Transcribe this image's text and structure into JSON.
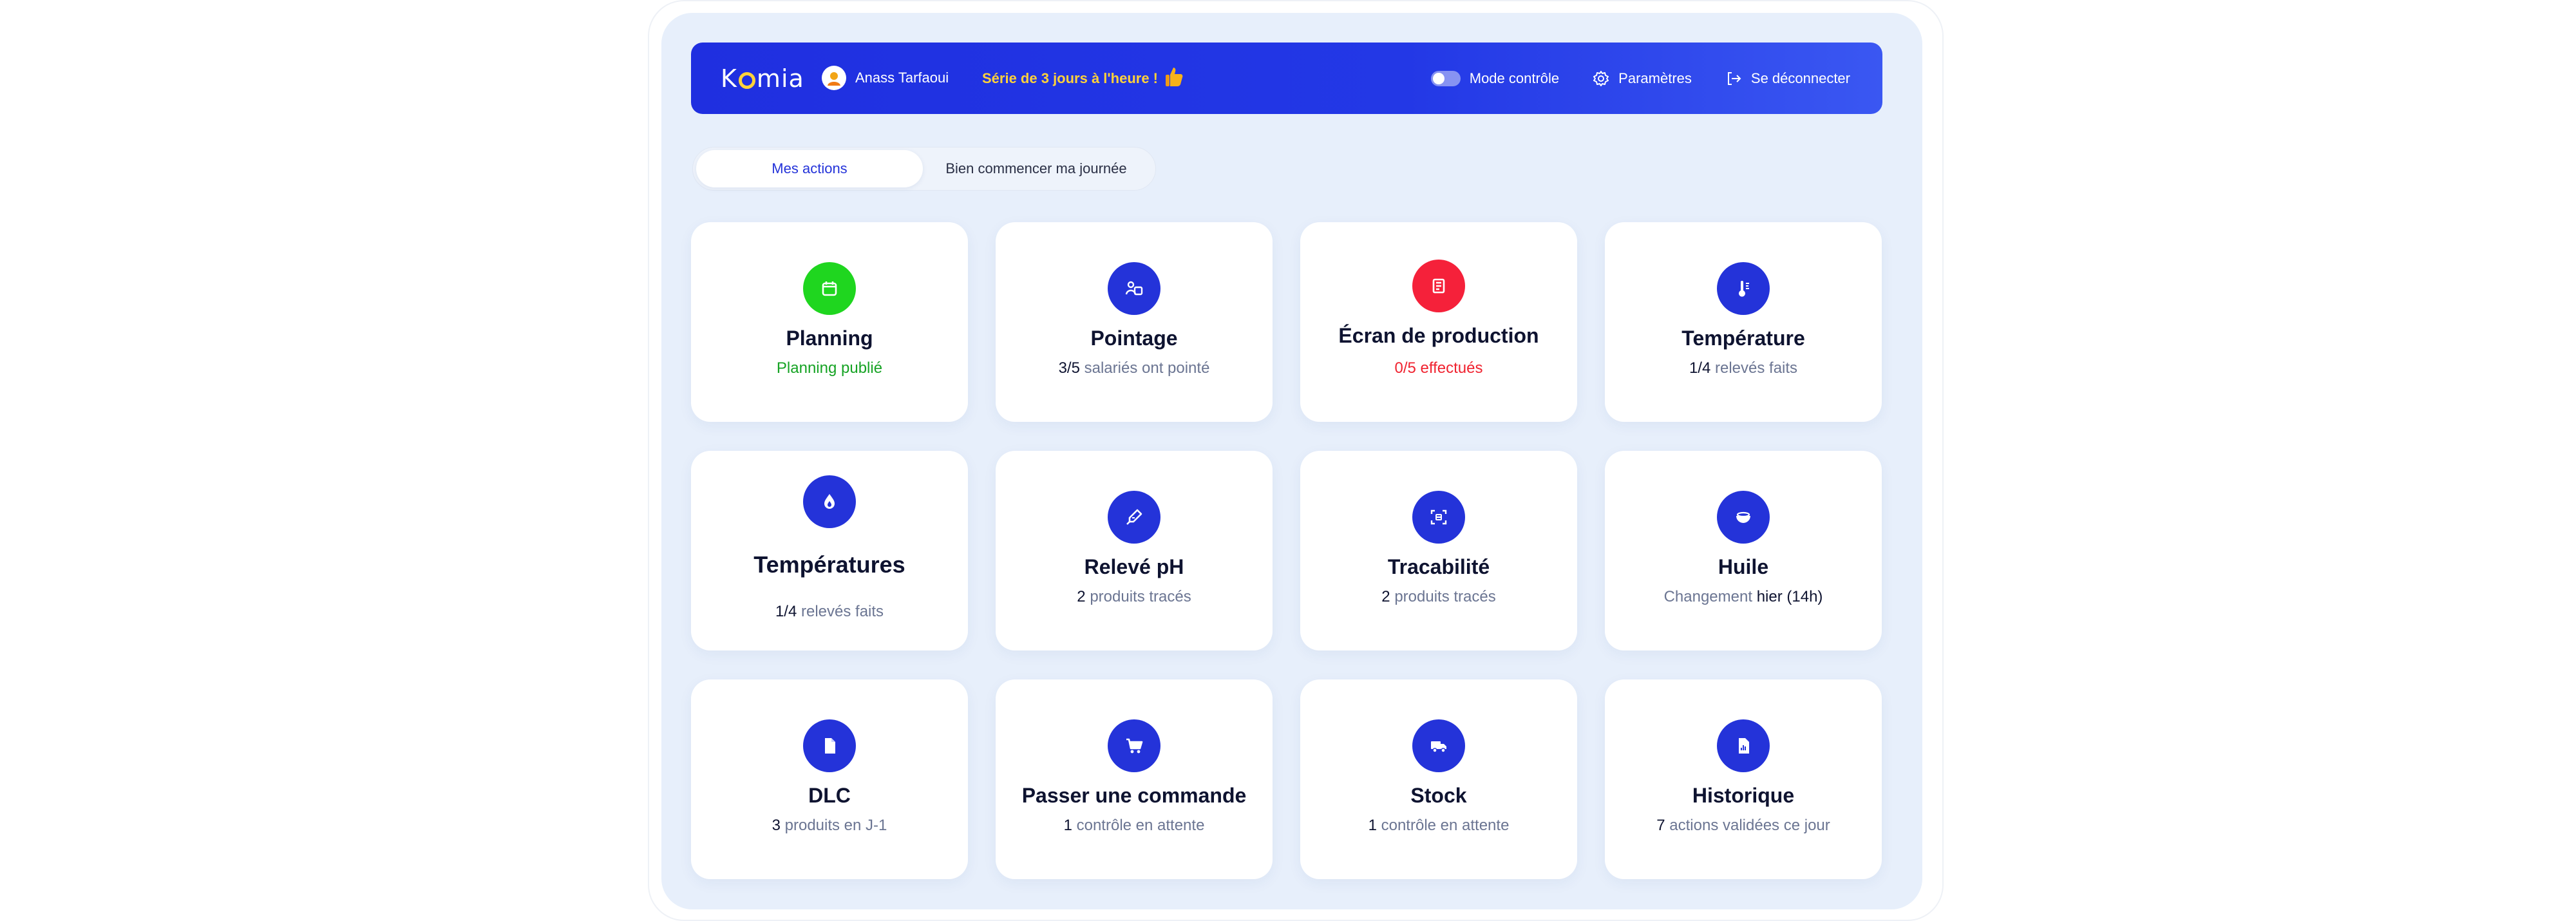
{
  "header": {
    "logo_text_1": "K",
    "logo_text_2": "mia",
    "user_name": "Anass Tarfaoui",
    "streak": "Série de 3 jours à l'heure !",
    "control_mode": "Mode contrôle",
    "settings": "Paramètres",
    "logout": "Se déconnecter"
  },
  "tabs": [
    {
      "label": "Mes actions",
      "active": true
    },
    {
      "label": "Bien commencer ma journée",
      "active": false
    }
  ],
  "cards": [
    {
      "title": "Planning",
      "sub_text": "Planning publié",
      "icon": "calendar-icon",
      "color": "#1fd61f"
    },
    {
      "title": "Pointage",
      "sub_value": "3/5",
      "sub_text": "salariés ont pointé",
      "icon": "clock-in-icon",
      "color": "#2433d9"
    },
    {
      "title": "Écran de production",
      "sub_text": "0/5 effectués",
      "icon": "production-screen-icon",
      "color": "#f5213a"
    },
    {
      "title": "Température",
      "sub_value": "1/4",
      "sub_text": "relevés faits",
      "icon": "thermometer-icon",
      "color": "#2433d9"
    },
    {
      "title": "Températures",
      "sub_value": "1/4",
      "sub_text": "relevés faits",
      "icon": "flame-icon",
      "color": "#2433d9"
    },
    {
      "title": "Relevé pH",
      "sub_value": "2",
      "sub_text": "produits tracés",
      "icon": "ph-pipette-icon",
      "color": "#2433d9"
    },
    {
      "title": "Tracabilité",
      "sub_value": "2",
      "sub_text": "produits tracés",
      "icon": "scan-icon",
      "color": "#2433d9"
    },
    {
      "title": "Huile",
      "sub_text": "Changement",
      "sub_value": "hier (14h)",
      "icon": "oil-bowl-icon",
      "color": "#2433d9"
    },
    {
      "title": "DLC",
      "sub_value": "3",
      "sub_text": "produits en J-1",
      "icon": "document-icon",
      "color": "#2433d9"
    },
    {
      "title": "Passer une commande",
      "sub_value": "1",
      "sub_text": "contrôle en attente",
      "icon": "cart-icon",
      "color": "#2433d9"
    },
    {
      "title": "Stock",
      "sub_value": "1",
      "sub_text": "contrôle en attente",
      "icon": "truck-icon",
      "color": "#2433d9"
    },
    {
      "title": "Historique",
      "sub_value": "7",
      "sub_text": "actions validées ce jour",
      "icon": "history-file-icon",
      "color": "#2433d9"
    }
  ]
}
